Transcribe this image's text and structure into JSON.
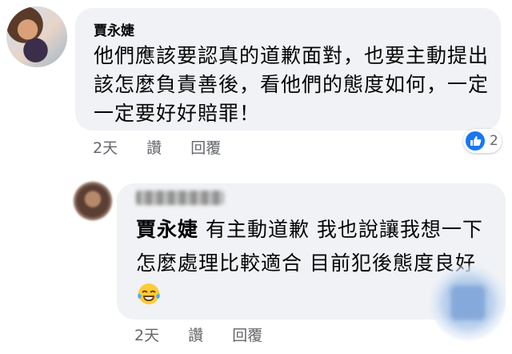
{
  "comment1": {
    "author": "賈永婕",
    "text": "他們應該要認真的道歉面對，也要主動提出該怎麼負責善後，看他們的態度如何，一定一定要好好賠罪！",
    "time": "2天",
    "read_label": "讚",
    "reply_label": "回覆",
    "reaction_icon": "like-icon",
    "reaction_count": "2"
  },
  "reply1": {
    "author_blurred": true,
    "mention": "賈永婕",
    "text": " 有主動道歉 我也說讓我想一下怎麼處理比較適合 目前犯後態度良好",
    "emoji": "tears-of-joy-emoji",
    "time": "2天",
    "read_label": "讚",
    "reply_label": "回覆"
  },
  "colors": {
    "bubble": "#f0f2f5",
    "text": "#050505",
    "meta": "#65676b",
    "like_blue": "#1877f2"
  }
}
